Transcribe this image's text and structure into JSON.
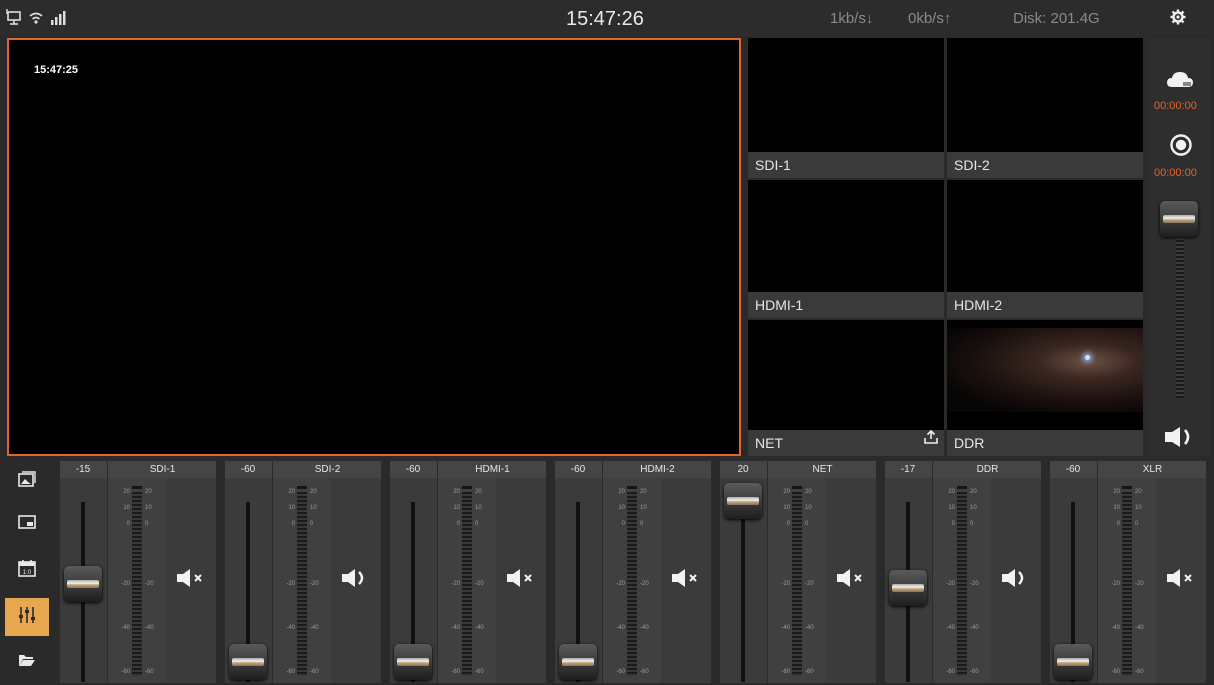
{
  "statusbar": {
    "clock": "15:47:26",
    "net_down": "1kb/s↓",
    "net_up": "0kb/s↑",
    "disk": "Disk: 201.4G",
    "icons": [
      "network-icon",
      "wifi-icon",
      "cellular-signal-icon",
      "gear-icon"
    ]
  },
  "preview": {
    "timestamp": "15:47:25",
    "border_color": "#e0652a"
  },
  "sources": [
    {
      "label": "SDI-1"
    },
    {
      "label": "SDI-2"
    },
    {
      "label": "HDMI-1"
    },
    {
      "label": "HDMI-2"
    },
    {
      "label": "NET"
    },
    {
      "label": "DDR"
    }
  ],
  "right_panel": {
    "stream_timer": "00:00:00",
    "record_timer": "00:00:00",
    "icons": [
      "cloud-stream-icon",
      "record-icon",
      "speaker-icon"
    ]
  },
  "toolbar": {
    "tools": [
      "multiview-icon",
      "picture-in-picture-icon",
      "clock-timer-icon",
      "audio-mixer-icon",
      "folder-icon"
    ],
    "active_tool": "audio-mixer-icon",
    "accent_color": "#e7a74f"
  },
  "mixer": {
    "meter_scale": [
      "20",
      "10",
      "0",
      "-20",
      "-40",
      "-60"
    ],
    "channels": [
      {
        "name": "SDI-1",
        "level": "-15",
        "muted": true
      },
      {
        "name": "SDI-2",
        "level": "-60",
        "muted": false
      },
      {
        "name": "HDMI-1",
        "level": "-60",
        "muted": true
      },
      {
        "name": "HDMI-2",
        "level": "-60",
        "muted": true
      },
      {
        "name": "NET",
        "level": "20",
        "muted": true
      },
      {
        "name": "DDR",
        "level": "-17",
        "muted": false
      },
      {
        "name": "XLR",
        "level": "-60",
        "muted": true
      }
    ]
  }
}
